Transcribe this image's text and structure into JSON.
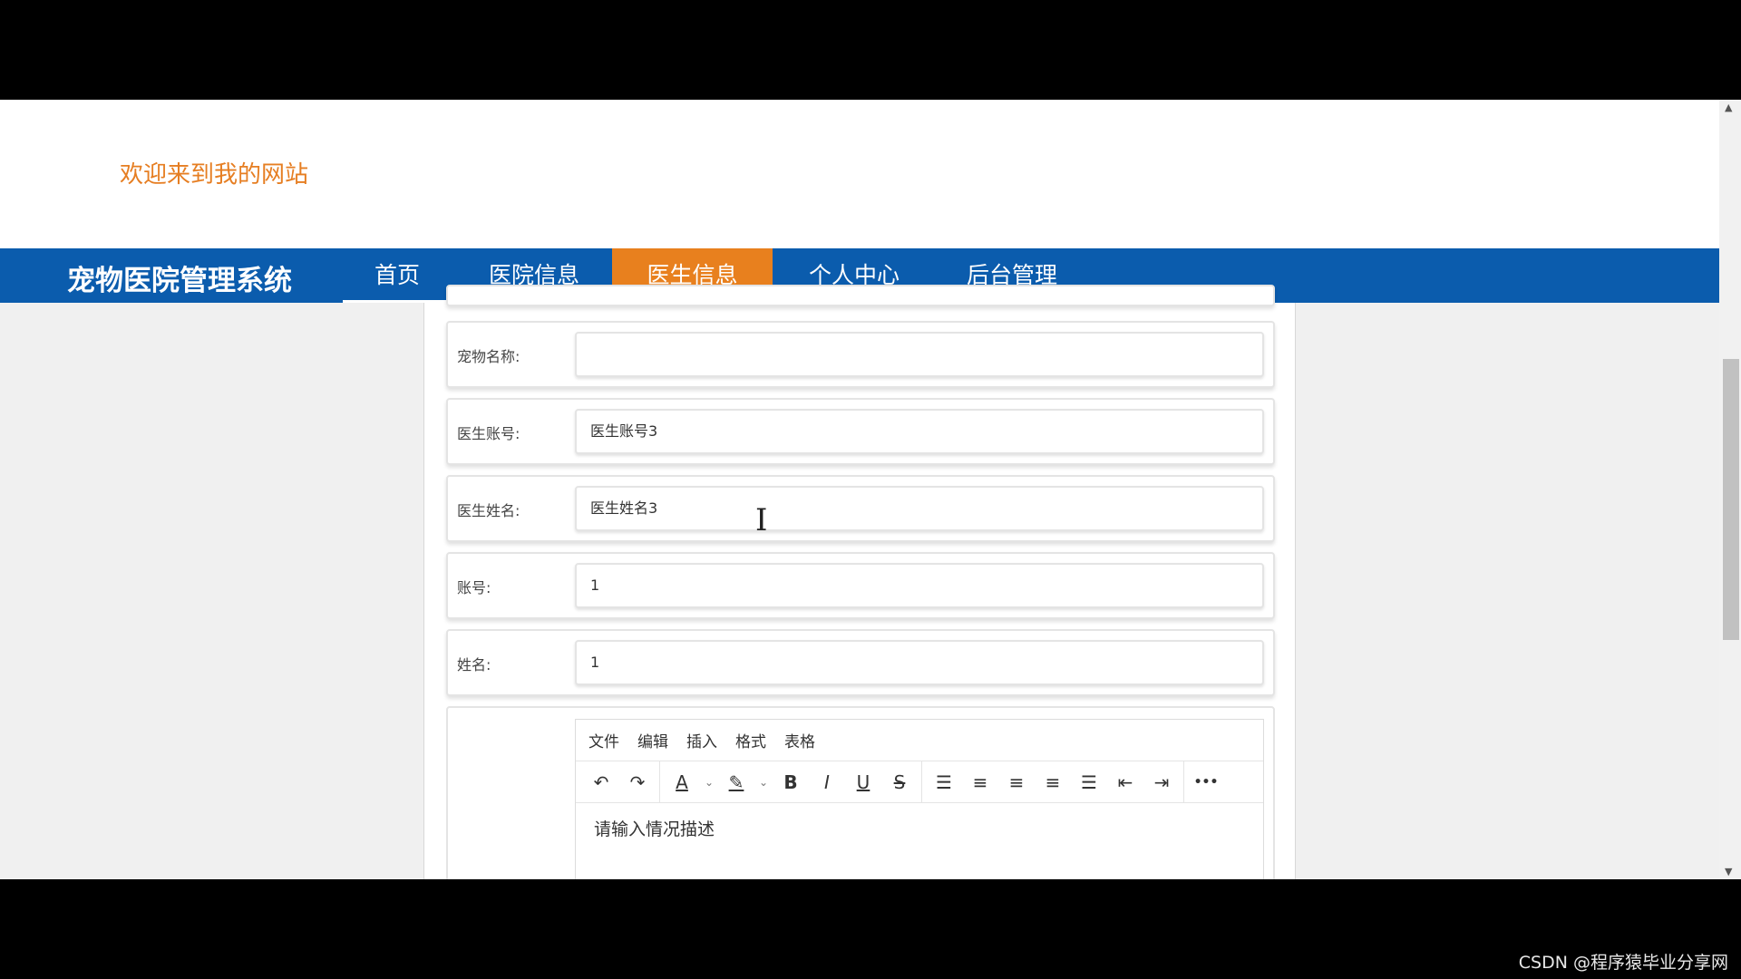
{
  "header": {
    "welcome": "欢迎来到我的网站",
    "brand": "宠物医院管理系统"
  },
  "nav": {
    "items": [
      {
        "label": "首页"
      },
      {
        "label": "医院信息"
      },
      {
        "label": "医生信息"
      },
      {
        "label": "个人中心"
      },
      {
        "label": "后台管理"
      }
    ],
    "active": "医生信息"
  },
  "form": {
    "fields": [
      {
        "label": "宠物名称:",
        "value": ""
      },
      {
        "label": "医生账号:",
        "value": "医生账号3"
      },
      {
        "label": "医生姓名:",
        "value": "医生姓名3"
      },
      {
        "label": "账号:",
        "value": "1"
      },
      {
        "label": "姓名:",
        "value": "1"
      }
    ]
  },
  "editor": {
    "menu": [
      "文件",
      "编辑",
      "插入",
      "格式",
      "表格"
    ],
    "placeholder": "请输入情况描述",
    "toolbar_icons": [
      "undo-icon",
      "redo-icon",
      "text-color-icon",
      "highlight-icon",
      "bold-icon",
      "italic-icon",
      "underline-icon",
      "strikethrough-icon",
      "line-height-icon",
      "align-left-icon",
      "align-center-icon",
      "align-right-icon",
      "align-justify-icon",
      "outdent-icon",
      "indent-icon",
      "more-icon"
    ],
    "text_color_label": "A",
    "bold_label": "B",
    "italic_label": "I",
    "underline_label": "U",
    "strike_label": "S"
  },
  "colors": {
    "nav_bg": "#0b5cad",
    "nav_active": "#e8801e",
    "welcome": "#e67e22"
  },
  "watermark": "CSDN @程序猿毕业分享网"
}
